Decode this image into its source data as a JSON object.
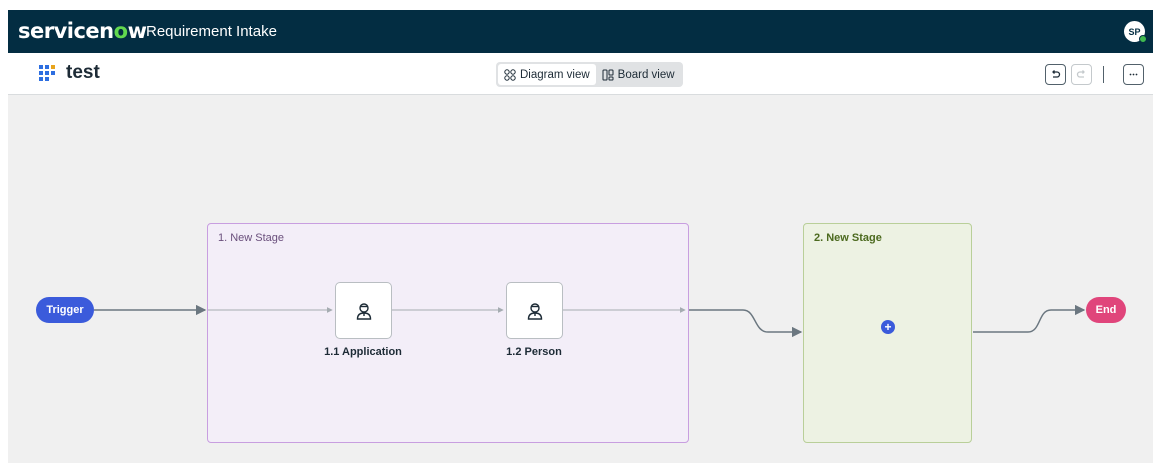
{
  "topbar": {
    "brand_prefix": "servicen",
    "brand_o": "o",
    "brand_suffix": "w",
    "app_title": "Requirement Intake",
    "avatar_initials": "SP"
  },
  "header": {
    "project_name": "test",
    "views": [
      {
        "label": "Diagram view",
        "icon": "diagram-icon",
        "active": true
      },
      {
        "label": "Board view",
        "icon": "board-icon",
        "active": false
      }
    ],
    "undo_icon": "undo-icon",
    "redo_icon": "redo-icon",
    "more_icon": "more-icon"
  },
  "flow": {
    "trigger_label": "Trigger",
    "end_label": "End",
    "stages": [
      {
        "title": "1. New Stage",
        "activities": [
          {
            "label": "1.1 Application",
            "icon": "person-icon"
          },
          {
            "label": "1.2 Person",
            "icon": "person-icon"
          }
        ]
      },
      {
        "title": "2. New Stage",
        "add_icon": "plus-icon"
      }
    ]
  },
  "colors": {
    "topbar": "#032d42",
    "brand_accent": "#62d84e",
    "trigger": "#3b5bdb",
    "end": "#e0457b",
    "stage1_fill": "#f3eef8",
    "stage1_border": "#c89ee0",
    "stage2_fill": "#edf2e3",
    "stage2_border": "#b9cf99",
    "add": "#3b5bdb"
  }
}
